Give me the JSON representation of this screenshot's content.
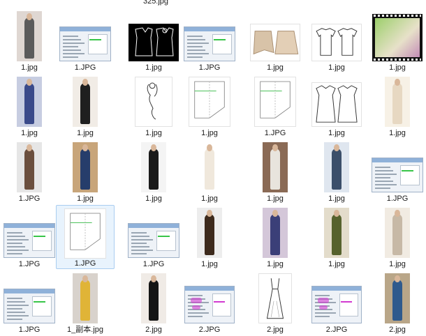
{
  "top_caption": "325.jpg",
  "rows": [
    [
      {
        "caption": "1.jpg",
        "kind": "photo",
        "colors": [
          "#5b5b5b",
          "#dfd7d2"
        ]
      },
      {
        "caption": "1.JPG",
        "kind": "dialog"
      },
      {
        "caption": "1.jpg",
        "kind": "black"
      },
      {
        "caption": "1.JPG",
        "kind": "dialog"
      },
      {
        "caption": "1.jpg",
        "kind": "skirts"
      },
      {
        "caption": "1.jpg",
        "kind": "tees"
      },
      {
        "caption": "1.jpg",
        "kind": "film"
      }
    ],
    [
      {
        "caption": "1.jpg",
        "kind": "photo",
        "colors": [
          "#3a4a8a",
          "#c7cde1"
        ]
      },
      {
        "caption": "1.jpg",
        "kind": "photo",
        "colors": [
          "#1f1f1f",
          "#f1ece6"
        ]
      },
      {
        "caption": "1.jpg",
        "kind": "sketch"
      },
      {
        "caption": "1.jpg",
        "kind": "pattern"
      },
      {
        "caption": "1.JPG",
        "kind": "pattern"
      },
      {
        "caption": "1.jpg",
        "kind": "dresses"
      },
      {
        "caption": "1.jpg",
        "kind": "photo",
        "colors": [
          "#e7d8c2",
          "#f7f1e6"
        ]
      }
    ],
    [
      {
        "caption": "1.JPG",
        "kind": "photo",
        "colors": [
          "#6b4f3e",
          "#e6e6e6"
        ]
      },
      {
        "caption": "1.jpg",
        "kind": "photo",
        "colors": [
          "#263d6b",
          "#c8a57a"
        ]
      },
      {
        "caption": "1.jpg",
        "kind": "photo",
        "colors": [
          "#1b1b1b",
          "#f4f4f4"
        ]
      },
      {
        "caption": "1.jpg",
        "kind": "photo",
        "colors": [
          "#f0e8dc",
          "#ffffff"
        ]
      },
      {
        "caption": "1.jpg",
        "kind": "photo",
        "colors": [
          "#e8e4dd",
          "#8a6a55"
        ]
      },
      {
        "caption": "1.jpg",
        "kind": "photo",
        "colors": [
          "#3b4f6a",
          "#dfe6ef"
        ]
      },
      {
        "caption": "1.JPG",
        "kind": "dialog"
      }
    ],
    [
      {
        "caption": "1.JPG",
        "kind": "dialog"
      },
      {
        "caption": "1.JPG",
        "kind": "pattern",
        "selected": true
      },
      {
        "caption": "1.JPG",
        "kind": "dialog"
      },
      {
        "caption": "1.jpg",
        "kind": "photo",
        "colors": [
          "#3d2a1c",
          "#ededed"
        ]
      },
      {
        "caption": "1.jpg",
        "kind": "photo",
        "colors": [
          "#3b3f78",
          "#d4c7d9"
        ]
      },
      {
        "caption": "1.jpg",
        "kind": "photo",
        "colors": [
          "#56622d",
          "#e3dccb"
        ]
      },
      {
        "caption": "1.jpg",
        "kind": "photo",
        "colors": [
          "#c7b9a6",
          "#f1ebe2"
        ]
      }
    ],
    [
      {
        "caption": "1.JPG",
        "kind": "dialog"
      },
      {
        "caption": "1_副本.jpg",
        "kind": "photo",
        "colors": [
          "#e0b437",
          "#d8d2cc"
        ]
      },
      {
        "caption": "2.jpg",
        "kind": "photo",
        "colors": [
          "#151515",
          "#f0ebe6"
        ]
      },
      {
        "caption": "2.JPG",
        "kind": "dialog_pink"
      },
      {
        "caption": "2.jpg",
        "kind": "gown"
      },
      {
        "caption": "2.JPG",
        "kind": "dialog_pink"
      },
      {
        "caption": "2.jpg",
        "kind": "photo",
        "colors": [
          "#2f5a8d",
          "#b9a688"
        ]
      }
    ]
  ]
}
